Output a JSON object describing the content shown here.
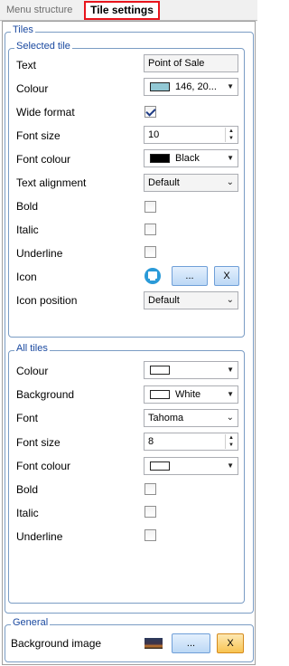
{
  "tabs": {
    "inactive": "Menu structure",
    "active": "Tile settings"
  },
  "tiles_group": {
    "legend": "Tiles"
  },
  "selected_tile": {
    "legend": "Selected tile",
    "text_label": "Text",
    "text_value": "Point of Sale",
    "colour_label": "Colour",
    "colour_value": "146, 20...",
    "colour_swatch": "#92c8d4",
    "wide_label": "Wide format",
    "wide_checked": true,
    "font_size_label": "Font size",
    "font_size_value": "10",
    "font_colour_label": "Font colour",
    "font_colour_value": "Black",
    "font_colour_swatch": "#000000",
    "text_alignment_label": "Text alignment",
    "text_alignment_value": "Default",
    "bold_label": "Bold",
    "italic_label": "Italic",
    "underline_label": "Underline",
    "icon_label": "Icon",
    "icon_browse": "...",
    "icon_clear": "X",
    "icon_position_label": "Icon position",
    "icon_position_value": "Default"
  },
  "all_tiles": {
    "legend": "All tiles",
    "colour_label": "Colour",
    "colour_swatch": "#ffffff",
    "background_label": "Background",
    "background_value": "White",
    "background_swatch": "#ffffff",
    "font_label": "Font",
    "font_value": "Tahoma",
    "font_size_label": "Font size",
    "font_size_value": "8",
    "font_colour_label": "Font colour",
    "font_colour_swatch": "#ffffff",
    "bold_label": "Bold",
    "italic_label": "Italic",
    "underline_label": "Underline"
  },
  "general": {
    "legend": "General",
    "background_image_label": "Background image",
    "browse": "...",
    "clear": "X"
  },
  "colors": {
    "accent_border": "#e8141c",
    "group_border": "#7a9cc4",
    "legend_text": "#1a49a0"
  }
}
